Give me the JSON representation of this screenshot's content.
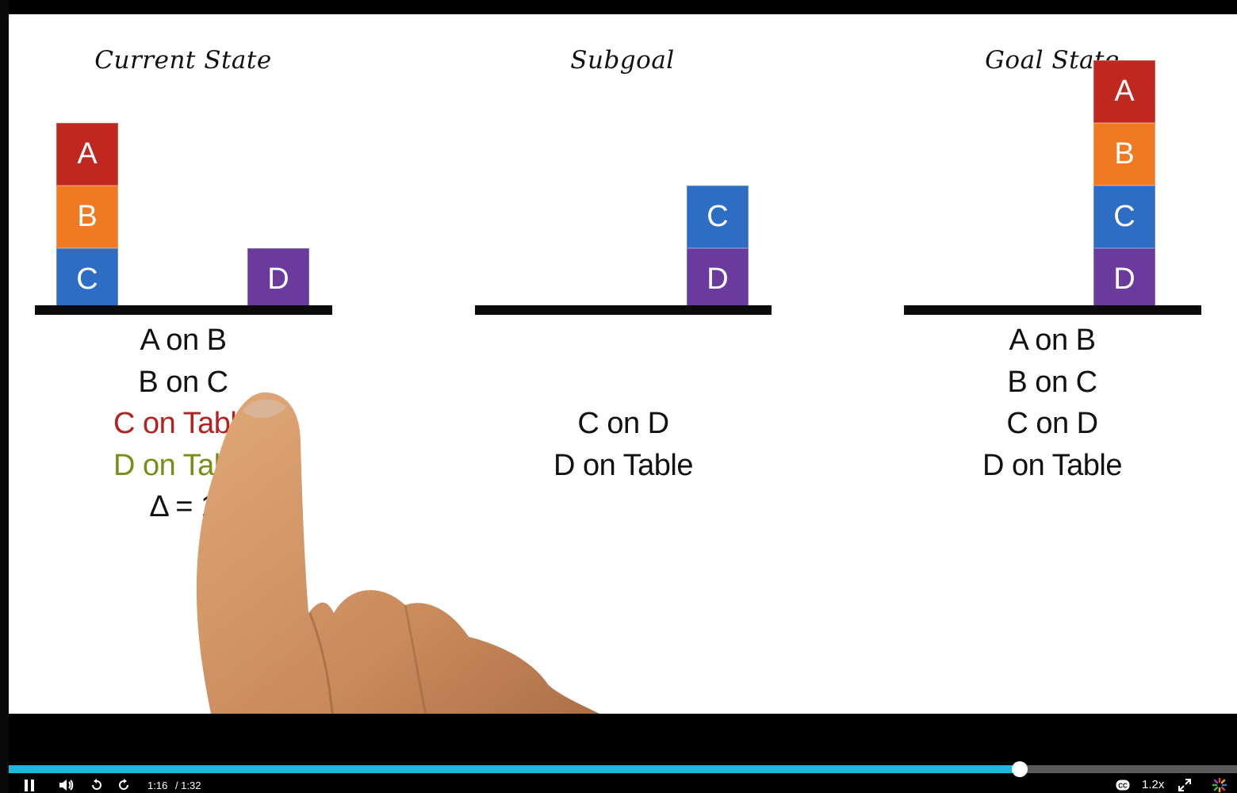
{
  "panels": {
    "current": {
      "title": "Current State",
      "stack_blocks": [
        "A",
        "B",
        "C"
      ],
      "single_block": "D",
      "predicates": [
        {
          "text": "A on B",
          "color": "#111111"
        },
        {
          "text": "B on C",
          "color": "#111111"
        },
        {
          "text": "C on Table",
          "color": "#b22222"
        },
        {
          "text": "D on Table",
          "color": "#7a8c1a"
        },
        {
          "text": "Δ = 1",
          "color": "#111111"
        }
      ]
    },
    "subgoal": {
      "title": "Subgoal",
      "stack_blocks": [
        "C",
        "D"
      ],
      "predicates": [
        {
          "text": "C on D",
          "color": "#111111"
        },
        {
          "text": "D on Table",
          "color": "#111111"
        }
      ]
    },
    "goal": {
      "title": "Goal State",
      "stack_blocks": [
        "A",
        "B",
        "C",
        "D"
      ],
      "predicates": [
        {
          "text": "A on B",
          "color": "#111111"
        },
        {
          "text": "B on C",
          "color": "#111111"
        },
        {
          "text": "C on D",
          "color": "#111111"
        },
        {
          "text": "D on Table",
          "color": "#111111"
        }
      ]
    }
  },
  "block_colors": {
    "A": "#c0281f",
    "B": "#f07a22",
    "C": "#2d6dc4",
    "D": "#6a3a9c"
  },
  "player": {
    "current_time": "1:16",
    "duration": "/ 1:32",
    "progress": 0.823,
    "speed": "1.2x",
    "progress_color": "#1fb6e0",
    "icons": [
      "pause-icon",
      "volume-icon",
      "rewind-icon",
      "forward-icon",
      "cc-icon",
      "fullscreen-icon",
      "logo-icon"
    ]
  }
}
